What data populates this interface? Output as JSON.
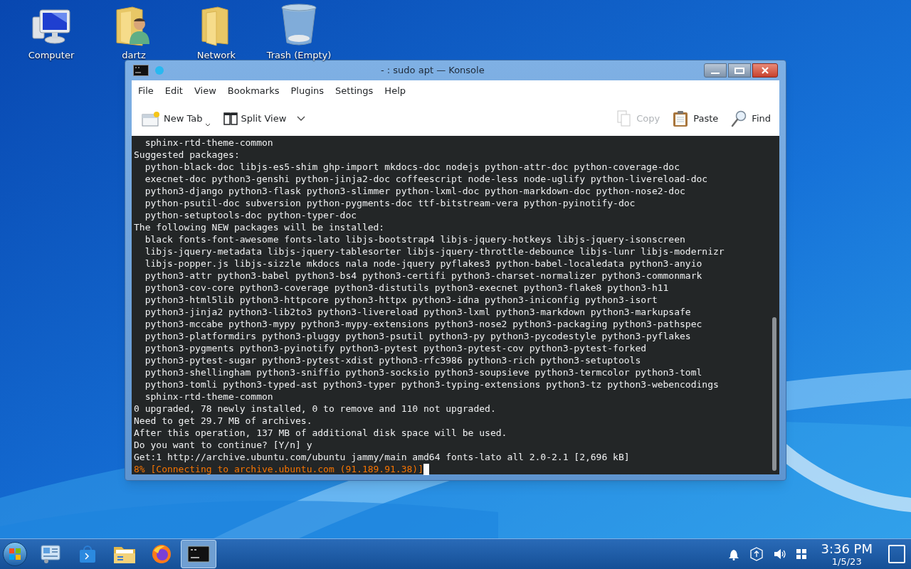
{
  "desktop_icons": [
    {
      "label": "Computer",
      "kind": "computer"
    },
    {
      "label": "dartz",
      "kind": "home"
    },
    {
      "label": "Network",
      "kind": "folder"
    },
    {
      "label": "Trash (Empty)",
      "kind": "trash"
    }
  ],
  "window": {
    "title": "- : sudo apt — Konsole",
    "menu": [
      "File",
      "Edit",
      "View",
      "Bookmarks",
      "Plugins",
      "Settings",
      "Help"
    ],
    "toolbar_left": [
      {
        "label": "New Tab",
        "kind": "newtab"
      },
      {
        "label": "Split View",
        "kind": "split"
      }
    ],
    "toolbar_right": [
      {
        "label": "Copy",
        "kind": "copy",
        "disabled": true
      },
      {
        "label": "Paste",
        "kind": "paste",
        "disabled": false
      },
      {
        "label": "Find",
        "kind": "find",
        "disabled": false
      }
    ],
    "terminal_lines": [
      {
        "text": "  sphinx-rtd-theme-common",
        "kind": "output"
      },
      {
        "text": "Suggested packages:",
        "kind": "output"
      },
      {
        "text": "  python-black-doc libjs-es5-shim ghp-import mkdocs-doc nodejs python-attr-doc python-coverage-doc",
        "kind": "output"
      },
      {
        "text": "  execnet-doc python3-genshi python-jinja2-doc coffeescript node-less node-uglify python-livereload-doc",
        "kind": "output"
      },
      {
        "text": "  python3-django python3-flask python3-slimmer python-lxml-doc python-markdown-doc python-nose2-doc",
        "kind": "output"
      },
      {
        "text": "  python-psutil-doc subversion python-pygments-doc ttf-bitstream-vera python-pyinotify-doc",
        "kind": "output"
      },
      {
        "text": "  python-setuptools-doc python-typer-doc",
        "kind": "output"
      },
      {
        "text": "The following NEW packages will be installed:",
        "kind": "output"
      },
      {
        "text": "  black fonts-font-awesome fonts-lato libjs-bootstrap4 libjs-jquery-hotkeys libjs-jquery-isonscreen",
        "kind": "output"
      },
      {
        "text": "  libjs-jquery-metadata libjs-jquery-tablesorter libjs-jquery-throttle-debounce libjs-lunr libjs-modernizr",
        "kind": "output"
      },
      {
        "text": "  libjs-popper.js libjs-sizzle mkdocs nala node-jquery pyflakes3 python-babel-localedata python3-anyio",
        "kind": "output"
      },
      {
        "text": "  python3-attr python3-babel python3-bs4 python3-certifi python3-charset-normalizer python3-commonmark",
        "kind": "output"
      },
      {
        "text": "  python3-cov-core python3-coverage python3-distutils python3-execnet python3-flake8 python3-h11",
        "kind": "output"
      },
      {
        "text": "  python3-html5lib python3-httpcore python3-httpx python3-idna python3-iniconfig python3-isort",
        "kind": "output"
      },
      {
        "text": "  python3-jinja2 python3-lib2to3 python3-livereload python3-lxml python3-markdown python3-markupsafe",
        "kind": "output"
      },
      {
        "text": "  python3-mccabe python3-mypy python3-mypy-extensions python3-nose2 python3-packaging python3-pathspec",
        "kind": "output"
      },
      {
        "text": "  python3-platformdirs python3-pluggy python3-psutil python3-py python3-pycodestyle python3-pyflakes",
        "kind": "output"
      },
      {
        "text": "  python3-pygments python3-pyinotify python3-pytest python3-pytest-cov python3-pytest-forked",
        "kind": "output"
      },
      {
        "text": "  python3-pytest-sugar python3-pytest-xdist python3-rfc3986 python3-rich python3-setuptools",
        "kind": "output"
      },
      {
        "text": "  python3-shellingham python3-sniffio python3-socksio python3-soupsieve python3-termcolor python3-toml",
        "kind": "output"
      },
      {
        "text": "  python3-tomli python3-typed-ast python3-typer python3-typing-extensions python3-tz python3-webencodings",
        "kind": "output"
      },
      {
        "text": "  sphinx-rtd-theme-common",
        "kind": "output"
      },
      {
        "text": "0 upgraded, 78 newly installed, 0 to remove and 110 not upgraded.",
        "kind": "output"
      },
      {
        "text": "Need to get 29.7 MB of archives.",
        "kind": "output"
      },
      {
        "text": "After this operation, 137 MB of additional disk space will be used.",
        "kind": "output"
      },
      {
        "text": "Do you want to continue? [Y/n] y",
        "kind": "output"
      },
      {
        "text": "Get:1 http://archive.ubuntu.com/ubuntu jammy/main amd64 fonts-lato all 2.0-2.1 [2,696 kB]",
        "kind": "output"
      },
      {
        "text": "8% [Connecting to archive.ubuntu.com (91.189.91.38)]",
        "kind": "progress",
        "cursor": true
      }
    ]
  },
  "taskbar": {
    "apps": [
      {
        "kind": "control",
        "selected": false
      },
      {
        "kind": "store",
        "selected": false
      },
      {
        "kind": "files",
        "selected": false
      },
      {
        "kind": "browser",
        "selected": false
      },
      {
        "kind": "terminal",
        "selected": true
      }
    ],
    "tray": [
      {
        "kind": "bell"
      },
      {
        "kind": "update"
      },
      {
        "kind": "volume"
      },
      {
        "kind": "grid"
      }
    ],
    "time": "3:36 PM",
    "date": "1/5/23"
  }
}
